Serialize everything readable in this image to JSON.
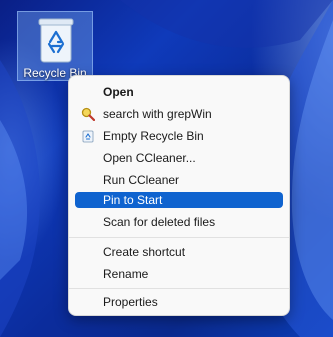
{
  "desktop": {
    "recycle_bin_label": "Recycle Bin"
  },
  "context_menu": {
    "items": [
      {
        "label": "Open",
        "icon": null
      },
      {
        "label": "search with grepWin",
        "icon": "magnifier-icon"
      },
      {
        "label": "Empty Recycle Bin",
        "icon": "recycle-bin-icon"
      },
      {
        "label": "Open CCleaner...",
        "icon": null
      },
      {
        "label": "Run CCleaner",
        "icon": null
      },
      {
        "label": "Pin to Start",
        "icon": null,
        "highlighted": true
      },
      {
        "label": "Scan for deleted files",
        "icon": null
      },
      {
        "label": "Create shortcut",
        "icon": null
      },
      {
        "label": "Rename",
        "icon": null
      },
      {
        "label": "Properties",
        "icon": null
      }
    ]
  },
  "colors": {
    "highlight": "#0f63cf",
    "menu_bg": "#f9f9f9",
    "wallpaper": "#0b2c9c"
  }
}
